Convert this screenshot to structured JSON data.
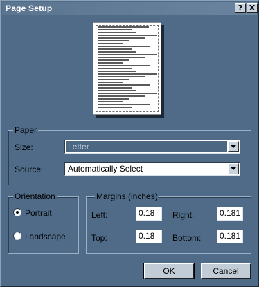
{
  "window": {
    "title": "Page Setup",
    "help_button": "?",
    "close_button": "X"
  },
  "paper": {
    "group_label": "Paper",
    "size_label": "Size:",
    "size_value": "Letter",
    "source_label": "Source:",
    "source_value": "Automatically Select"
  },
  "orientation": {
    "group_label": "Orientation",
    "options": [
      {
        "label": "Portrait",
        "selected": true
      },
      {
        "label": "Landscape",
        "selected": false
      }
    ]
  },
  "margins": {
    "group_label": "Margins (inches)",
    "left_label": "Left:",
    "left_value": "0.18",
    "right_label": "Right:",
    "right_value": "0.181",
    "top_label": "Top:",
    "top_value": "0.18",
    "bottom_label": "Bottom:",
    "bottom_value": "0.181"
  },
  "buttons": {
    "ok": "OK",
    "cancel": "Cancel"
  },
  "colors": {
    "dialog_bg": "#4f6b88",
    "selected_field": "#4c6782",
    "button_face": "#c2ccd6"
  },
  "icons": {
    "help": "question-mark-icon",
    "close": "close-icon",
    "dropdown": "chevron-down-icon"
  }
}
